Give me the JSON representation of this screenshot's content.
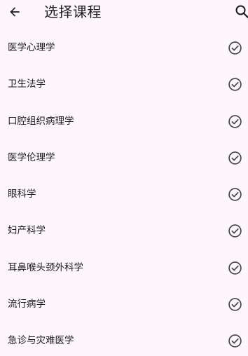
{
  "header": {
    "title": "选择课程",
    "back_icon": "arrow-back-icon",
    "search_icon": "search-icon"
  },
  "courses": [
    {
      "label": "医学心理学",
      "selected": true
    },
    {
      "label": "卫生法学",
      "selected": true
    },
    {
      "label": "口腔组织病理学",
      "selected": true
    },
    {
      "label": "医学伦理学",
      "selected": true
    },
    {
      "label": "眼科学",
      "selected": true
    },
    {
      "label": "妇产科学",
      "selected": true
    },
    {
      "label": "耳鼻喉头颈外科学",
      "selected": true
    },
    {
      "label": "流行病学",
      "selected": true
    },
    {
      "label": "急诊与灾难医学",
      "selected": true
    }
  ],
  "colors": {
    "background": "#fdf7fd",
    "text": "#1c1b1f",
    "icon": "#444444"
  }
}
